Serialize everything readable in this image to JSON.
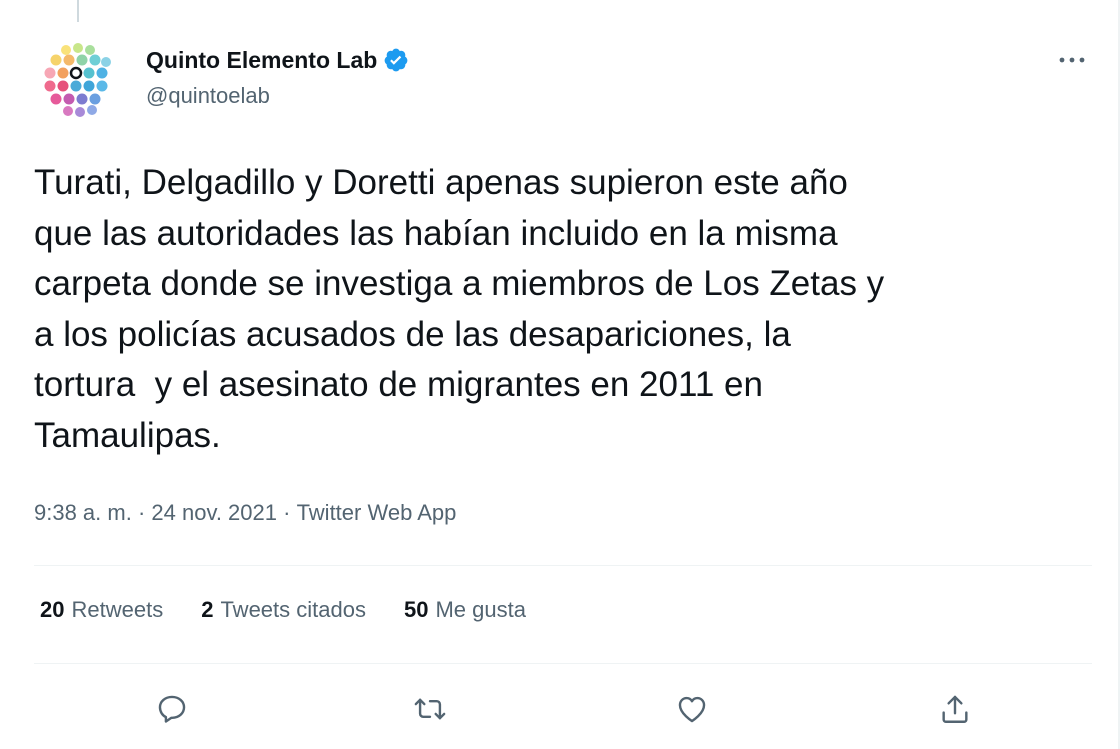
{
  "author": {
    "display_name": "Quinto Elemento Lab",
    "handle": "@quintoelab",
    "verified": true,
    "avatar_icon": "quintoelab-logo-icon"
  },
  "tweet": {
    "text": "Turati, Delgadillo y Doretti apenas supieron este año\nque las autoridades las habían incluido en la misma\ncarpeta donde se investiga a miembros de Los Zetas y\na los policías acusados de las desapariciones, la\ntortura  y el asesinato de migrantes en 2011 en\nTamaulipas.",
    "time": "9:38 a. m.",
    "separator": " · ",
    "date": "24 nov. 2021",
    "source": "Twitter Web App"
  },
  "stats": {
    "retweets": {
      "count": "20",
      "label": "Retweets"
    },
    "quotes": {
      "count": "2",
      "label": "Tweets citados"
    },
    "likes": {
      "count": "50",
      "label": "Me gusta"
    }
  },
  "actions": [
    "reply-icon",
    "retweet-icon",
    "like-icon",
    "share-icon"
  ],
  "colors": {
    "text": "#0f1419",
    "secondary": "#536471",
    "verified": "#1d9bf0",
    "divider": "#eff3f4"
  }
}
